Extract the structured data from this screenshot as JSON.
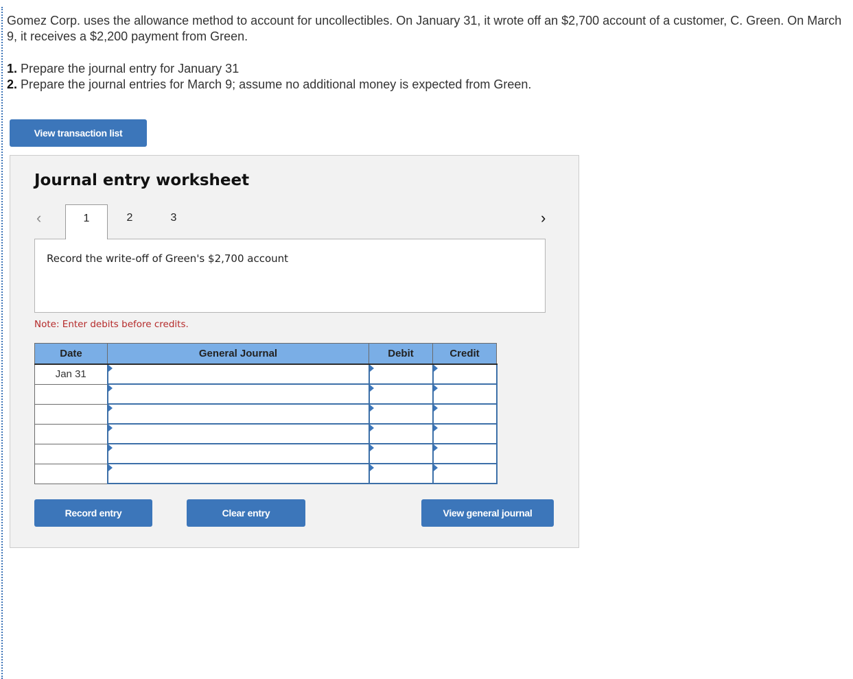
{
  "problem": {
    "text": "Gomez Corp. uses the allowance method to account for uncollectibles. On January 31, it wrote off an $2,700 account of a customer, C. Green. On March 9, it receives a $2,200 payment from Green.",
    "questions": [
      {
        "number": "1.",
        "text": " Prepare the journal entry for January 31"
      },
      {
        "number": "2.",
        "text": " Prepare the journal entries for March 9; assume no additional money is expected from Green."
      }
    ]
  },
  "buttons": {
    "view_transaction_list": "View transaction list",
    "record_entry": "Record entry",
    "clear_entry": "Clear entry",
    "view_general_journal": "View general journal"
  },
  "worksheet": {
    "title": "Journal entry worksheet",
    "prev_icon": "‹",
    "next_icon": "›",
    "tabs": [
      {
        "label": "1",
        "active": true
      },
      {
        "label": "2",
        "active": false
      },
      {
        "label": "3",
        "active": false
      }
    ],
    "description": "Record the write-off of Green's $2,700 account",
    "note": "Note: Enter debits before credits."
  },
  "journal": {
    "headers": [
      "Date",
      "General Journal",
      "Debit",
      "Credit"
    ],
    "rows": [
      {
        "date": "Jan 31",
        "account": "",
        "debit": "",
        "credit": ""
      },
      {
        "date": "",
        "account": "",
        "debit": "",
        "credit": ""
      },
      {
        "date": "",
        "account": "",
        "debit": "",
        "credit": ""
      },
      {
        "date": "",
        "account": "",
        "debit": "",
        "credit": ""
      },
      {
        "date": "",
        "account": "",
        "debit": "",
        "credit": ""
      },
      {
        "date": "",
        "account": "",
        "debit": "",
        "credit": ""
      }
    ]
  }
}
